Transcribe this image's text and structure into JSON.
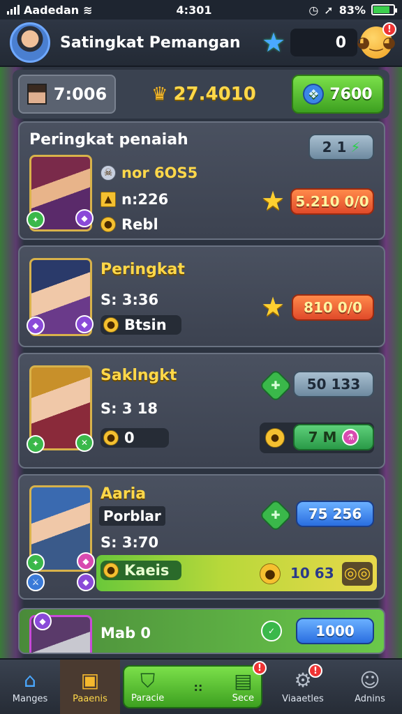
{
  "status_bar": {
    "carrier": "Aadedan",
    "time": "4:301",
    "battery_percent": "83%",
    "battery_level": 0.83
  },
  "header": {
    "title": "Satingkat Pemangan",
    "score": "0",
    "notification_count": "!"
  },
  "resources": {
    "timer": "7:006",
    "gold": "27.4010",
    "gems": "7600"
  },
  "cards": [
    {
      "title": "Peringkat penaiah",
      "stat1": "nor 6OS5",
      "stat2": "n:226",
      "stat3": "Rebl",
      "badge_value": "2 1",
      "reward_value": "5.210 0/0"
    },
    {
      "rank_name": "Peringkat",
      "stat1": "S: 3:36",
      "stat2": "Btsin",
      "reward_value": "810 0/0"
    },
    {
      "rank_name": "Saklngkt",
      "stat1": "S: 3 18",
      "stat2": "0",
      "badge_value": "50 133",
      "reward_value": "7 M"
    },
    {
      "rank_name": "Aaria",
      "tag": "Porblar",
      "stat1": "S: 3:70",
      "stat2": "Kaeis",
      "badge_value": "75 256",
      "reward_value": "10 63"
    },
    {
      "stat1": "Mab 0",
      "badge_value": "1000"
    }
  ],
  "bottom_nav": {
    "items": [
      {
        "label": "Manges",
        "icon": "home-icon"
      },
      {
        "label": "Paaenis",
        "icon": "chest-icon"
      },
      {
        "label": "Paracie",
        "icon": "shield-icon"
      },
      {
        "label": "Sece",
        "icon": "map-icon"
      },
      {
        "label": "Viaaetles",
        "icon": "gear-icon"
      },
      {
        "label": "Adnins",
        "icon": "profile-icon"
      }
    ],
    "center_dots": "::",
    "badge": "!"
  }
}
